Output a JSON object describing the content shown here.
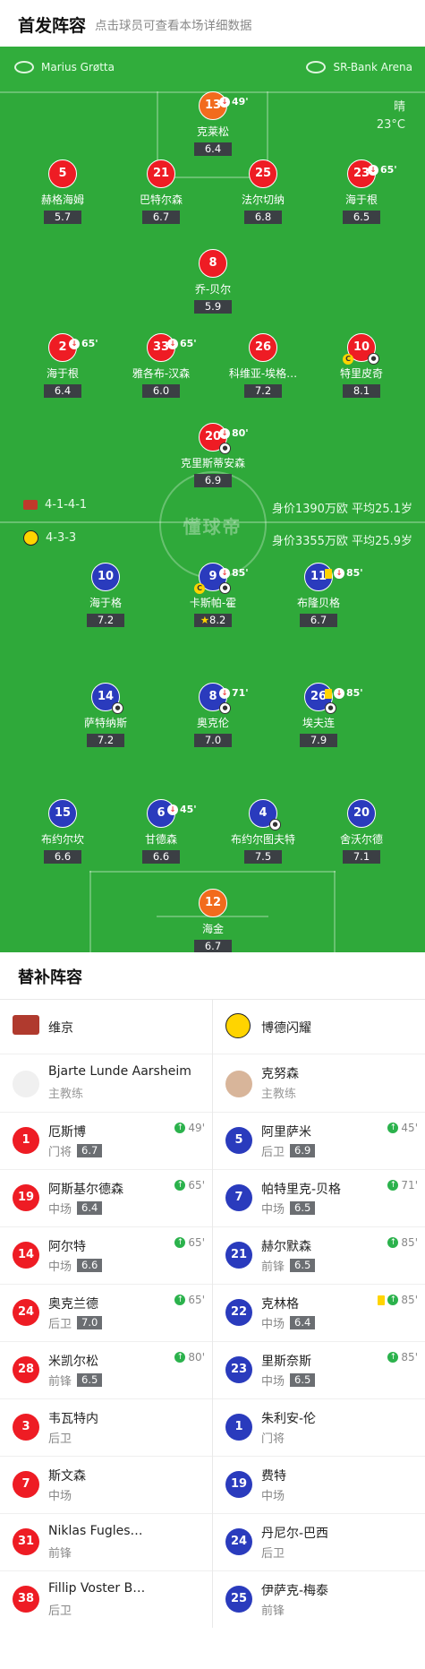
{
  "header": {
    "title": "首发阵容",
    "hint": "点击球员可查看本场详细数据"
  },
  "pitch": {
    "home_venue": "Marius Grøtta",
    "away_venue": "SR-Bank Arena",
    "weather": "晴",
    "temperature": "23°C",
    "watermark": "懂球帝",
    "home_formation": "4-1-4-1",
    "home_value": "身价1390万欧 平均25.1岁",
    "away_formation": "4-3-3",
    "away_value": "身价3355万欧 平均25.9岁"
  },
  "home_players": [
    {
      "num": "13",
      "name": "克莱松",
      "rating": "6.4",
      "sub": "49'"
    },
    {
      "num": "5",
      "name": "赫格海姆",
      "rating": "5.7"
    },
    {
      "num": "21",
      "name": "巴特尔森",
      "rating": "6.7"
    },
    {
      "num": "25",
      "name": "法尔切纳",
      "rating": "6.8"
    },
    {
      "num": "23",
      "name": "海于根",
      "rating": "6.5",
      "sub": "65'"
    },
    {
      "num": "8",
      "name": "乔-贝尔",
      "rating": "5.9"
    },
    {
      "num": "2",
      "name": "海于根",
      "rating": "6.4",
      "sub": "65'"
    },
    {
      "num": "33",
      "name": "雅各布-汉森",
      "rating": "6.0",
      "sub": "65'"
    },
    {
      "num": "26",
      "name": "科维亚-埃格…",
      "rating": "7.2"
    },
    {
      "num": "10",
      "name": "特里皮奇",
      "rating": "8.1"
    },
    {
      "num": "20",
      "name": "克里斯蒂安森",
      "rating": "6.9",
      "sub": "80'"
    }
  ],
  "away_players": [
    {
      "num": "10",
      "name": "海于格",
      "rating": "7.2"
    },
    {
      "num": "9",
      "name": "卡斯帕-霍",
      "rating": "8.2",
      "sub": "85'"
    },
    {
      "num": "11",
      "name": "布隆贝格",
      "rating": "6.7",
      "sub": "85'"
    },
    {
      "num": "14",
      "name": "萨特纳斯",
      "rating": "7.2"
    },
    {
      "num": "8",
      "name": "奥克伦",
      "rating": "7.0",
      "sub": "71'"
    },
    {
      "num": "26",
      "name": "埃夫连",
      "rating": "7.9",
      "sub": "85'"
    },
    {
      "num": "15",
      "name": "布约尔坎",
      "rating": "6.6"
    },
    {
      "num": "6",
      "name": "甘德森",
      "rating": "6.6",
      "sub": "45'"
    },
    {
      "num": "4",
      "name": "布约尔图夫特",
      "rating": "7.5"
    },
    {
      "num": "20",
      "name": "舍沃尔德",
      "rating": "7.1"
    },
    {
      "num": "12",
      "name": "海金",
      "rating": "6.7"
    }
  ],
  "subs": {
    "title": "替补阵容",
    "home_team": "维京",
    "away_team": "博德闪耀",
    "home_coach": {
      "name": "Bjarte Lunde Aarsheim",
      "role": "主教练"
    },
    "away_coach": {
      "name": "克努森",
      "role": "主教练"
    },
    "home": [
      {
        "num": "1",
        "name": "厄斯博",
        "pos": "门将",
        "rating": "6.7",
        "time": "49'"
      },
      {
        "num": "19",
        "name": "阿斯基尔德森",
        "pos": "中场",
        "rating": "6.4",
        "time": "65'"
      },
      {
        "num": "14",
        "name": "阿尔特",
        "pos": "中场",
        "rating": "6.6",
        "time": "65'"
      },
      {
        "num": "24",
        "name": "奥克兰德",
        "pos": "后卫",
        "rating": "7.0",
        "time": "65'"
      },
      {
        "num": "28",
        "name": "米凯尔松",
        "pos": "前锋",
        "rating": "6.5",
        "time": "80'"
      },
      {
        "num": "3",
        "name": "韦瓦特内",
        "pos": "后卫"
      },
      {
        "num": "7",
        "name": "斯文森",
        "pos": "中场"
      },
      {
        "num": "31",
        "name": "Niklas Fugles…",
        "pos": "前锋"
      },
      {
        "num": "38",
        "name": "Fillip Voster B…",
        "pos": "后卫"
      }
    ],
    "away": [
      {
        "num": "5",
        "name": "阿里萨米",
        "pos": "后卫",
        "rating": "6.9",
        "time": "45'"
      },
      {
        "num": "7",
        "name": "帕特里克-贝格",
        "pos": "中场",
        "rating": "6.5",
        "time": "71'"
      },
      {
        "num": "21",
        "name": "赫尔默森",
        "pos": "前锋",
        "rating": "6.5",
        "time": "85'"
      },
      {
        "num": "22",
        "name": "克林格",
        "pos": "中场",
        "rating": "6.4",
        "time": "85'"
      },
      {
        "num": "23",
        "name": "里斯奈斯",
        "pos": "中场",
        "rating": "6.5",
        "time": "85'"
      },
      {
        "num": "1",
        "name": "朱利安-伦",
        "pos": "门将"
      },
      {
        "num": "19",
        "name": "费特",
        "pos": "中场"
      },
      {
        "num": "24",
        "name": "丹尼尔-巴西",
        "pos": "后卫"
      },
      {
        "num": "25",
        "name": "伊萨克-梅泰",
        "pos": "前锋"
      }
    ]
  },
  "colors": {
    "pitch": "#2fa93a",
    "home": "#ee1c24",
    "away": "#2a3bbd",
    "keeper": "#f26b1d"
  }
}
